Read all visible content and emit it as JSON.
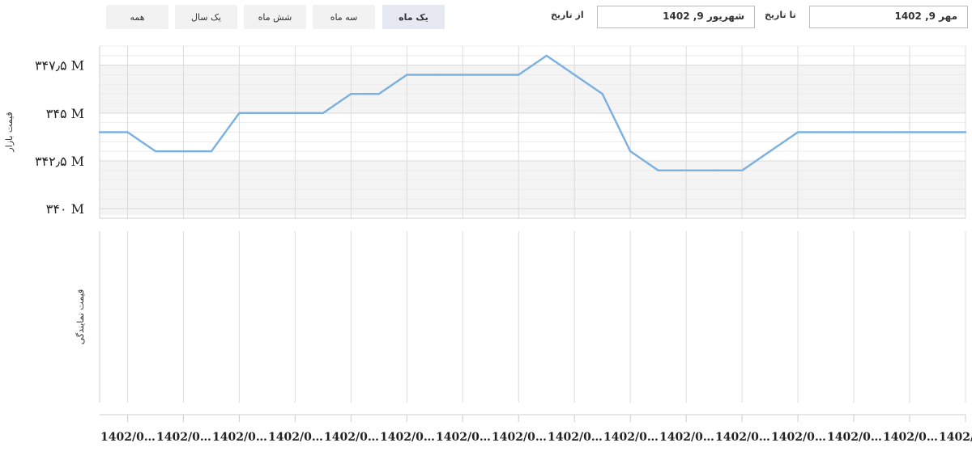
{
  "range_buttons": [
    {
      "label": "همه"
    },
    {
      "label": "یک سال"
    },
    {
      "label": "شش ماه"
    },
    {
      "label": "سه ماه"
    },
    {
      "label": "یک ماه"
    }
  ],
  "active_range_index": 4,
  "date_filter": {
    "from_label": "از تاریخ",
    "from_value": "شهریور 9, 1402",
    "to_label": "تا تاریخ",
    "to_value": "مهر 9, 1402"
  },
  "chart_data": [
    {
      "type": "line",
      "ylabel": "قیمت بازار",
      "ylim": [
        339.5,
        348.5
      ],
      "yticks": [
        340,
        342.5,
        345,
        347.5
      ],
      "ytick_labels": [
        "۳۴۰ M",
        "۳۴۲٫۵ M",
        "۳۴۵ M",
        "۳۴۷٫۵ M"
      ],
      "grid": true,
      "series": [
        {
          "color": "#7cb0e0",
          "x": [
            0,
            1,
            2,
            3,
            4,
            5,
            6,
            7,
            8,
            9,
            10,
            11,
            12,
            13,
            14,
            15,
            16,
            17,
            18,
            19,
            20,
            21,
            22,
            23,
            24,
            25,
            26,
            27,
            28,
            29,
            30,
            31
          ],
          "values": [
            344,
            344,
            343,
            343,
            343,
            345,
            345,
            345,
            345,
            346,
            346,
            347,
            347,
            347,
            347,
            347,
            348,
            347,
            346,
            343,
            342,
            342,
            342,
            342,
            343,
            344,
            344,
            344,
            344,
            344,
            344,
            344
          ]
        }
      ]
    },
    {
      "type": "line",
      "ylabel": "قیمت نمایندگی",
      "series": []
    }
  ],
  "x_tick_labels": [
    "1402/0…",
    "1402/0…",
    "1402/0…",
    "1402/0…",
    "1402/0…",
    "1402/0…",
    "1402/0…",
    "1402/0…",
    "1402/0…",
    "1402/0…",
    "1402/0…",
    "1402/0…",
    "1402/0…",
    "1402/0…",
    "1402/0…",
    "1402/0…",
    "14…"
  ]
}
